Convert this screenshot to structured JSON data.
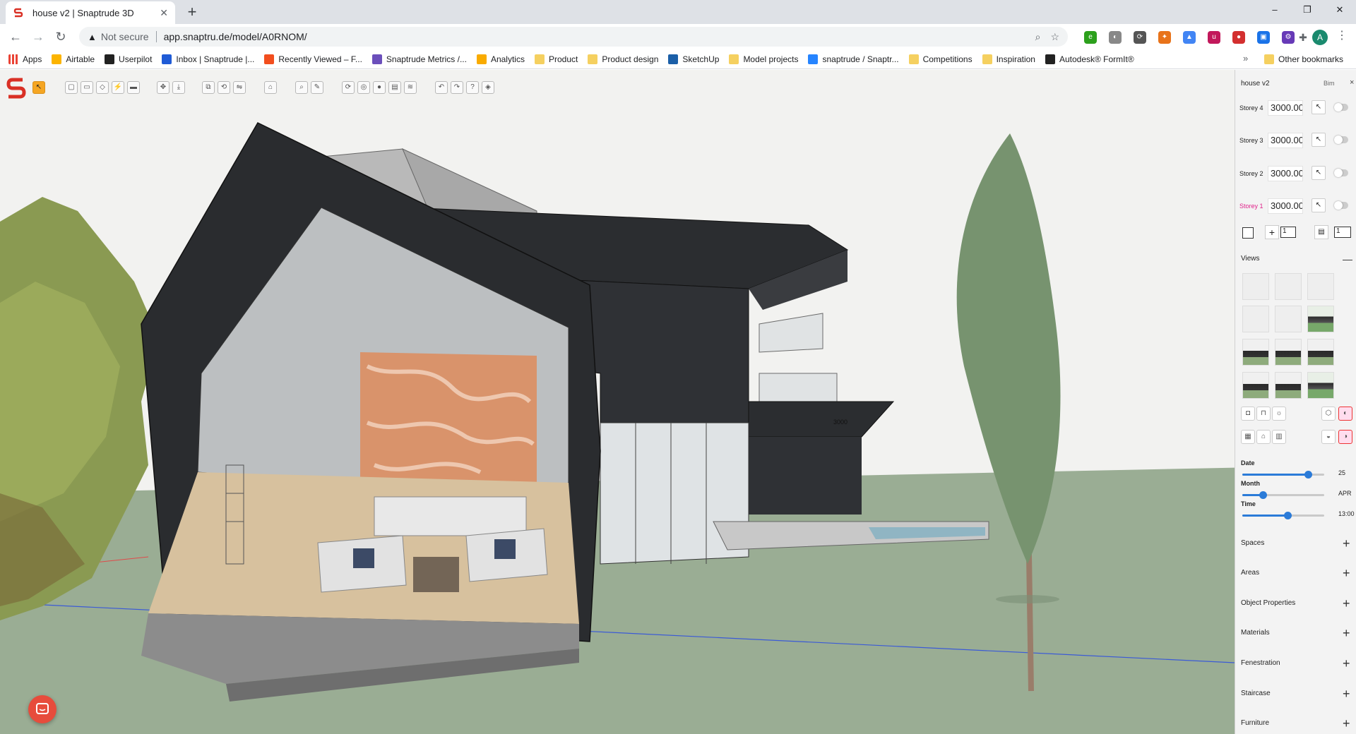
{
  "browser": {
    "tab_title": "house v2 | Snaptrude 3D",
    "tab_close": "✕",
    "new_tab": "+",
    "window_controls": [
      "–",
      "❐",
      "✕"
    ],
    "security_label": "Not secure",
    "url": "app.snaptru.de/model/A0RNOM/",
    "avatar_initial": "A",
    "bookmarks": [
      {
        "label": "Apps",
        "icon": "apps-grid-icon",
        "color": "#4285f4"
      },
      {
        "label": "Airtable",
        "icon": "airtable-icon",
        "color": "#fcb400"
      },
      {
        "label": "Userpilot",
        "icon": "userpilot-icon",
        "color": "#222222"
      },
      {
        "label": "Inbox | Snaptrude |...",
        "icon": "intercom-icon",
        "color": "#1f5bd6"
      },
      {
        "label": "Recently Viewed – F...",
        "icon": "figma-icon",
        "color": "#f24e1e"
      },
      {
        "label": "Snaptrude Metrics /...",
        "icon": "metrics-icon",
        "color": "#6b4fbb"
      },
      {
        "label": "Analytics",
        "icon": "analytics-icon",
        "color": "#f9ab00"
      },
      {
        "label": "Product",
        "icon": "folder-icon",
        "color": "#f5d060"
      },
      {
        "label": "Product design",
        "icon": "folder-icon",
        "color": "#f5d060"
      },
      {
        "label": "SketchUp",
        "icon": "sketchup-icon",
        "color": "#1b5fa8"
      },
      {
        "label": "Model projects",
        "icon": "folder-icon",
        "color": "#f5d060"
      },
      {
        "label": "snaptrude / Snaptr...",
        "icon": "jira-icon",
        "color": "#2684ff"
      },
      {
        "label": "Competitions",
        "icon": "folder-icon",
        "color": "#f5d060"
      },
      {
        "label": "Inspiration",
        "icon": "folder-icon",
        "color": "#f5d060"
      },
      {
        "label": "Autodesk® FormIt®",
        "icon": "formit-icon",
        "color": "#222222"
      }
    ],
    "bookmarks_more": "»",
    "other_bookmarks": "Other bookmarks"
  },
  "panel": {
    "project_name": "house v2",
    "units": "Bim",
    "close": "×",
    "storeys": [
      {
        "label": "Storey 4",
        "value": "3000.00",
        "active": false
      },
      {
        "label": "Storey 3",
        "value": "3000.00",
        "active": false
      },
      {
        "label": "Storey 2",
        "value": "3000.00",
        "active": false
      },
      {
        "label": "Storey 1",
        "value": "3000.00",
        "active": true
      }
    ],
    "add_storey_count": "1",
    "basement_count": "1",
    "views_label": "Views",
    "date": {
      "label": "Date",
      "value": "25",
      "fraction": 0.8
    },
    "month": {
      "label": "Month",
      "value": "APR",
      "fraction": 0.25
    },
    "time": {
      "label": "Time",
      "value": "13:00",
      "fraction": 0.55
    },
    "sections": [
      "Spaces",
      "Areas",
      "Object Properties",
      "Materials",
      "Fenestration",
      "Staircase",
      "Furniture"
    ]
  },
  "scene": {
    "dimension_label": "3000",
    "colors": {
      "sky": "#f2f2f0",
      "ground": "#9aad94",
      "roof": "#2b2d30",
      "accent": "#f5a623"
    }
  }
}
